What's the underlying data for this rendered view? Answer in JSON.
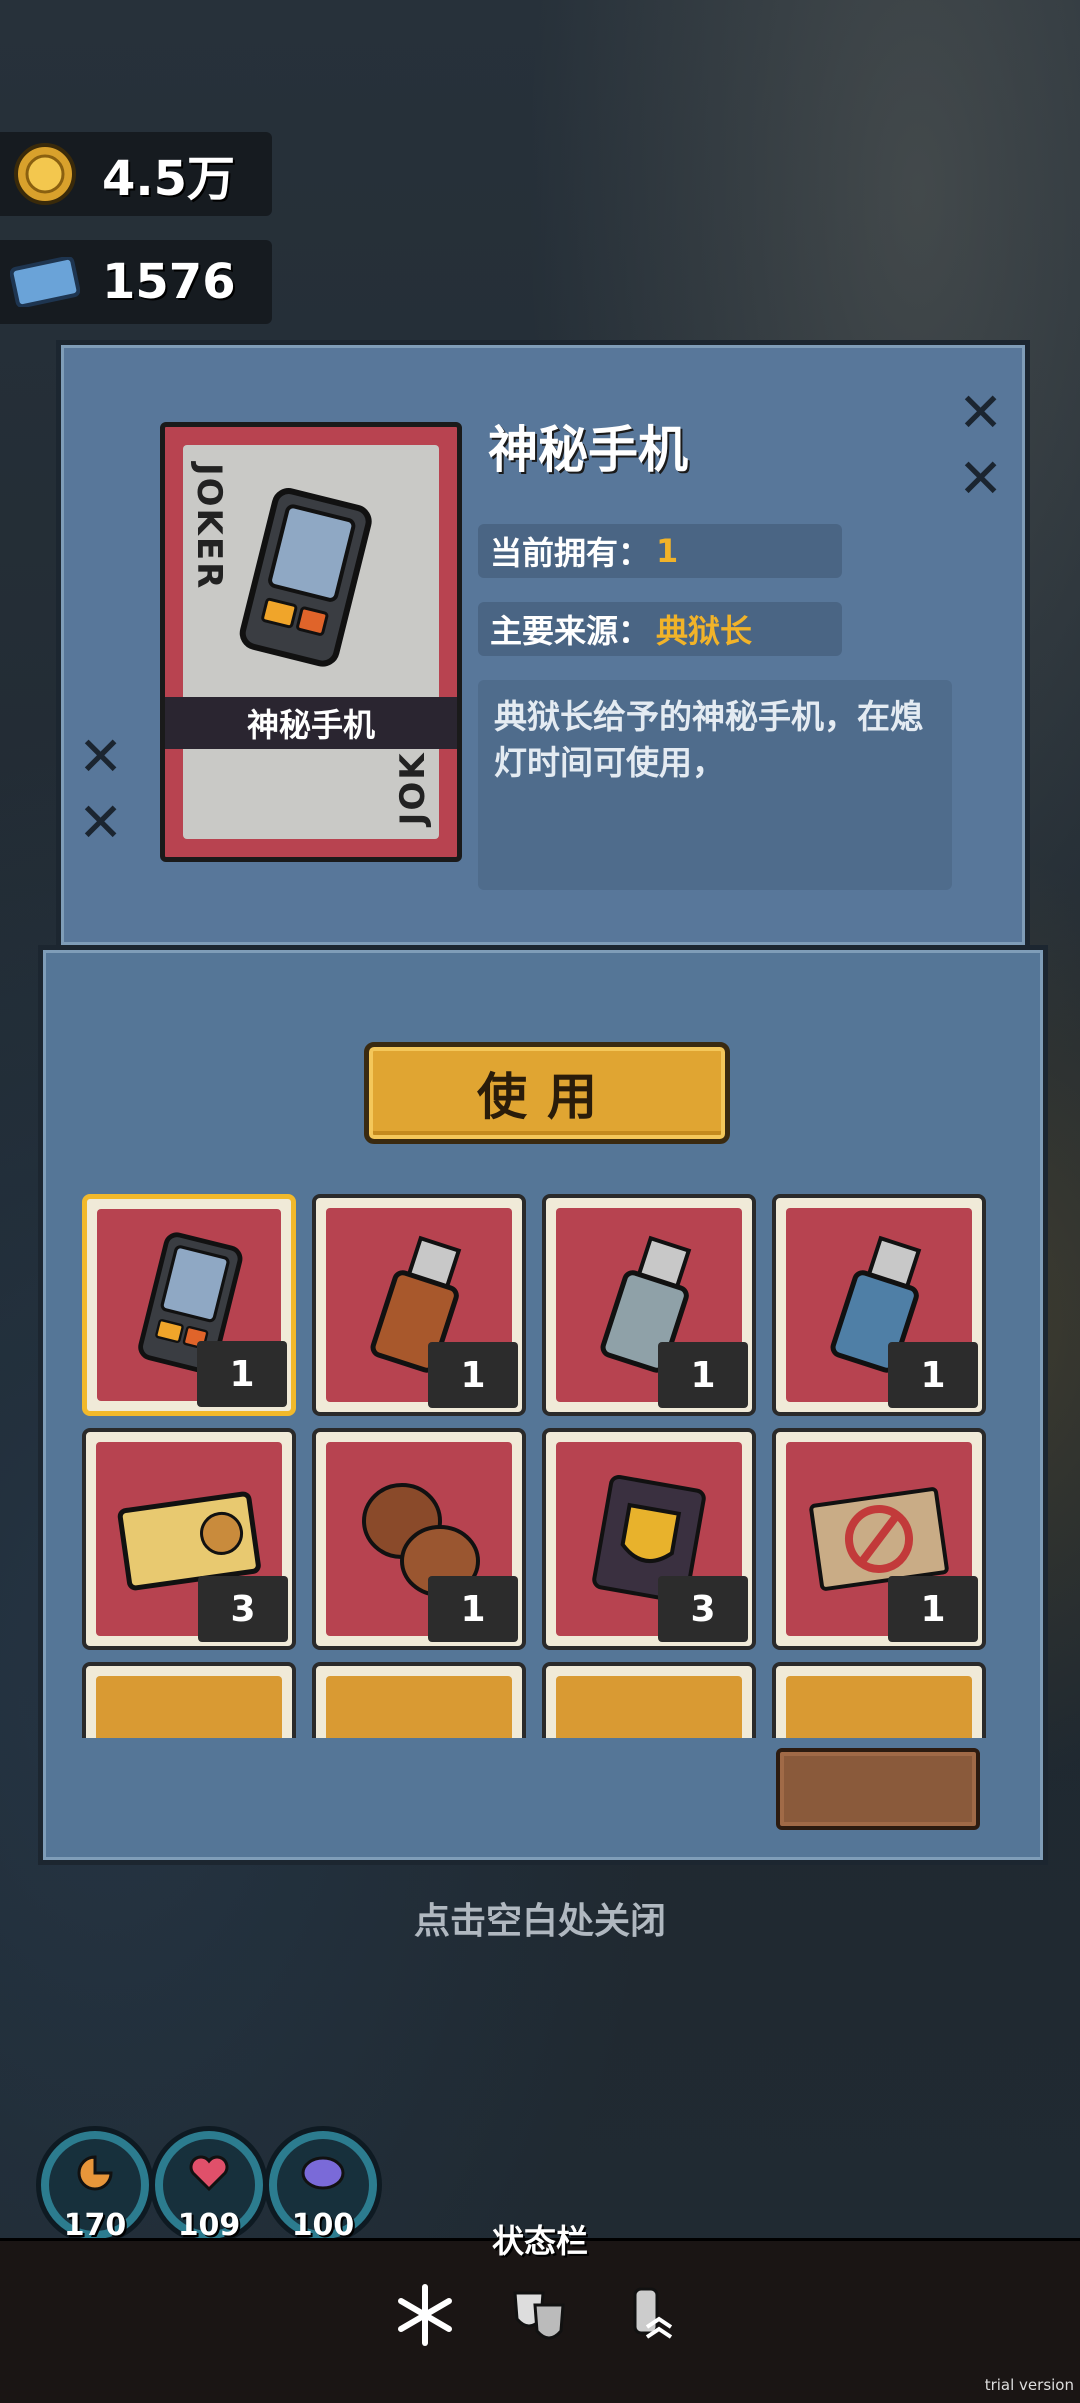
{
  "currency": {
    "coins": {
      "icon": "coin-icon",
      "value": "4.5万"
    },
    "tickets": {
      "icon": "ticket-icon",
      "value": "1576"
    }
  },
  "item_detail": {
    "title": "神秘手机",
    "card_label": "神秘手机",
    "card_corner_text": "JOKER",
    "owned_label": "当前拥有：",
    "owned_value": "1",
    "source_label": "主要来源：",
    "source_value": "典狱长",
    "description": "典狱长给予的神秘手机，在熄灯时间可使用，"
  },
  "use_button": "使用",
  "inventory": [
    {
      "name": "mysterious-phone",
      "count": "1",
      "selected": true
    },
    {
      "name": "usb-fox",
      "count": "1"
    },
    {
      "name": "usb-grey",
      "count": "1"
    },
    {
      "name": "usb-blue",
      "count": "1"
    },
    {
      "name": "id-card",
      "count": "3"
    },
    {
      "name": "walnuts",
      "count": "1"
    },
    {
      "name": "gold-badge",
      "count": "3"
    },
    {
      "name": "no-smoking-ticket",
      "count": "1"
    },
    {
      "name": "partial-item-1",
      "count": ""
    },
    {
      "name": "partial-item-2",
      "count": ""
    },
    {
      "name": "partial-item-3",
      "count": ""
    },
    {
      "name": "partial-item-4",
      "count": ""
    }
  ],
  "close_hint": "点击空白处关闭",
  "stats": [
    {
      "name": "hunger",
      "icon": "food-icon",
      "value": "170"
    },
    {
      "name": "health",
      "icon": "heart-icon",
      "value": "109"
    },
    {
      "name": "mind",
      "icon": "brain-icon",
      "value": "100"
    }
  ],
  "status_bar": {
    "title": "状态栏",
    "icons": [
      "snowflake-icon",
      "masks-icon",
      "bottle-rank-icon"
    ]
  },
  "watermark": "trial version",
  "colors": {
    "accent": "#f1b329",
    "panel": "#58779a",
    "card_red": "#b84350"
  }
}
